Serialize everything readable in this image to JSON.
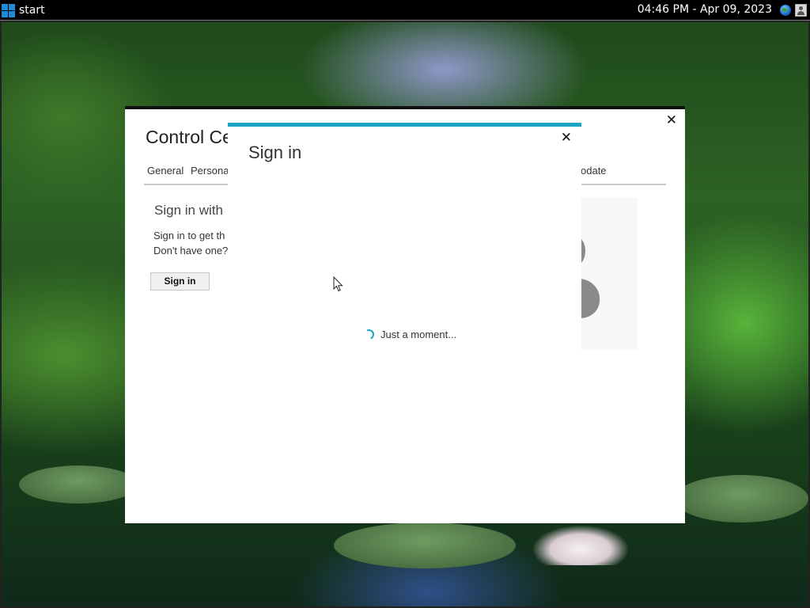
{
  "taskbar": {
    "start_label": "start",
    "clock": "04:46 PM - Apr 09, 2023",
    "tray_icons": [
      "globe-icon",
      "user-icon"
    ]
  },
  "control_center": {
    "title": "Control Ce",
    "tabs": [
      "General",
      "Persona",
      "odate"
    ],
    "heading": "Sign in with",
    "description_lines": [
      "Sign in to get th",
      "Don't have one?"
    ],
    "signin_button": "Sign in",
    "close_glyph": "✕"
  },
  "signin_dialog": {
    "title": "Sign in",
    "loading_text": "Just a moment...",
    "close_glyph": "✕",
    "accent_color": "#1aa3c3"
  }
}
